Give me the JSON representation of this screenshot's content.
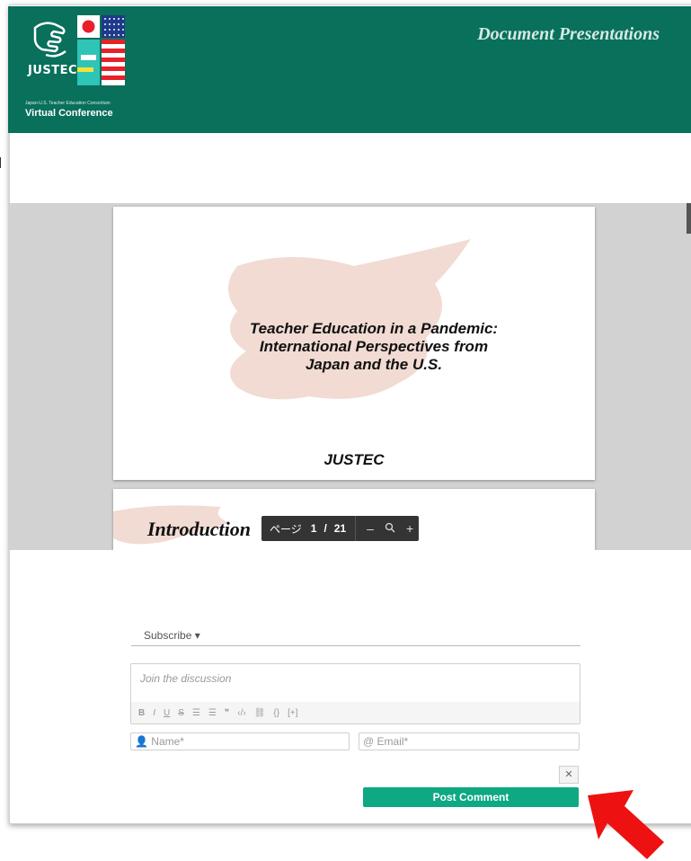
{
  "header": {
    "logo_text": "JUSTEC",
    "logo_subtitle": "Japan-U.S. Teacher Education Consortium",
    "logo_caption": "Virtual Conference",
    "section_title": "Document Presentations"
  },
  "viewer": {
    "slide1": {
      "title_line1": "Teacher Education in a Pandemic:",
      "title_line2": "International Perspectives from",
      "title_line3": "Japan and the U.S.",
      "footer": "JUSTEC"
    },
    "slide2": {
      "title": "Introduction"
    },
    "pager": {
      "label": "ページ",
      "current": "1",
      "separator": "/",
      "total": "21",
      "zoom_out": "–",
      "zoom_icon": "zoom-icon",
      "zoom_in": "+"
    }
  },
  "comments": {
    "subscribe_label": "Subscribe",
    "editor_placeholder": "Join the discussion",
    "toolbar": [
      "B",
      "I",
      "U",
      "S",
      "ol",
      "ul",
      "quote",
      "code",
      "link",
      "{}",
      "[+]"
    ],
    "name_placeholder": "Name*",
    "email_placeholder": "@ Email*",
    "post_button": "Post Comment"
  },
  "colors": {
    "header_bg": "#08705b",
    "post_button": "#0ea883",
    "arrow": "#ee1111"
  }
}
